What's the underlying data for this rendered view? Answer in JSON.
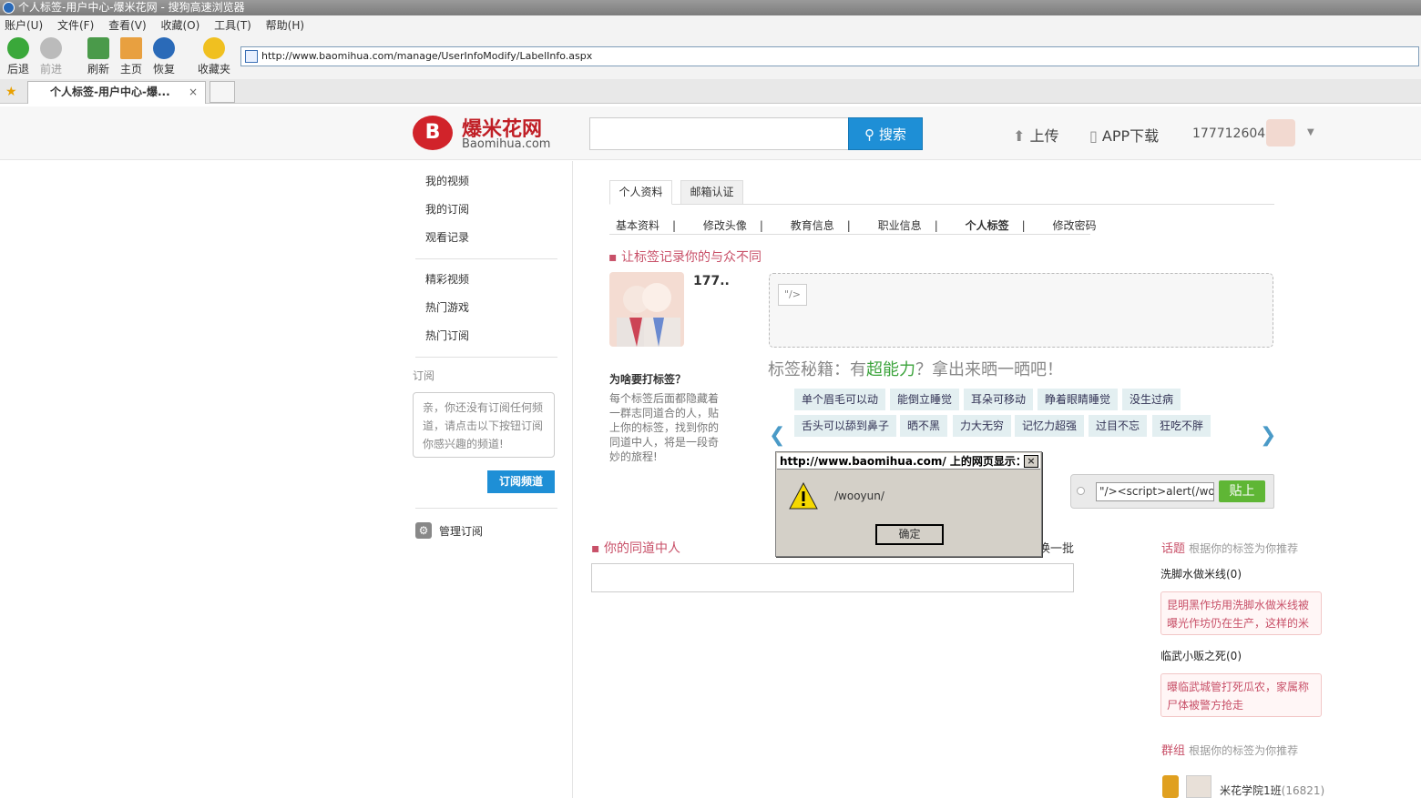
{
  "window": {
    "title": "个人标签-用户中心-爆米花网 - 搜狗高速浏览器"
  },
  "menu": [
    "账户(U)",
    "文件(F)",
    "查看(V)",
    "收藏(O)",
    "工具(T)",
    "帮助(H)"
  ],
  "toolbar": {
    "back": "后退",
    "forward": "前进",
    "refresh": "刷新",
    "home": "主页",
    "restore": "恢复",
    "favorites": "收藏夹"
  },
  "address": "http://www.baomihua.com/manage/UserInfoModify/LabelInfo.aspx",
  "tab": {
    "title": "个人标签-用户中心-爆...",
    "close": "×"
  },
  "header": {
    "logo_cn": "爆米花网",
    "logo_en": "Baomihua.com",
    "logo_mark": "B",
    "search_btn": "搜索",
    "upload": "上传",
    "app": "APP下载",
    "user": "177712604"
  },
  "sidebar": {
    "group1": [
      "我的视频",
      "我的订阅",
      "观看记录"
    ],
    "group2": [
      "精彩视频",
      "热门游戏",
      "热门订阅"
    ],
    "subs_label": "订阅",
    "subs_text": "亲，你还没有订阅任何频道，请点击以下按钮订阅你感兴趣的频道!",
    "subs_btn": "订阅频道",
    "manage": "管理订阅"
  },
  "tabs": {
    "profile": "个人资料",
    "email": "邮箱认证"
  },
  "subnav": [
    "基本资料",
    "修改头像",
    "教育信息",
    "职业信息",
    "个人标签",
    "修改密码"
  ],
  "subnav_sep": "|",
  "main": {
    "slogan": "让标签记录你的与众不同",
    "username": "177..",
    "why_title": "为啥要打标签？",
    "why_text": "每个标签后面都隐藏着一群志同道合的人，贴上你的标签，找到你的同道中人，将是一段奇妙的旅程!",
    "chip": "\"/>",
    "tips_a": "标签秘籍：有",
    "tips_b": "超能力",
    "tips_c": "？拿出来晒一晒吧！",
    "suggest_row1": [
      "单个眉毛可以动",
      "能倒立睡觉",
      "耳朵可移动",
      "睁着眼睛睡觉",
      "没生过病"
    ],
    "suggest_row2": [
      "舌头可以舔到鼻子",
      "晒不黑",
      "力大无穷",
      "记忆力超强",
      "过目不忘",
      "狂吃不胖"
    ],
    "tag_input": "\"/><script>alert(/wooyun/)",
    "tag_btn": "贴上",
    "peers": "你的同道中人",
    "peers_more": "换一批"
  },
  "right": {
    "topics": "话题",
    "topics_hint": "根据你的标签为你推荐",
    "t1": "洗脚水做米线(0)",
    "t1_desc": "昆明黑作坊用洗脚水做米线被曝光作坊仍在生产，这样的米线你还敢吃吗",
    "t2": "临武小贩之死(0)",
    "t2_desc": "曝临武城管打死瓜农，家属称尸体被警方抢走",
    "groups": "群组",
    "groups_hint": "根据你的标签为你推荐",
    "g1": "米花学院1班",
    "g1_count": "(16821)"
  },
  "dialog": {
    "title": "http://www.baomihua.com/ 上的网页显示：",
    "message": "/wooyun/",
    "ok": "确定",
    "close": "×"
  }
}
